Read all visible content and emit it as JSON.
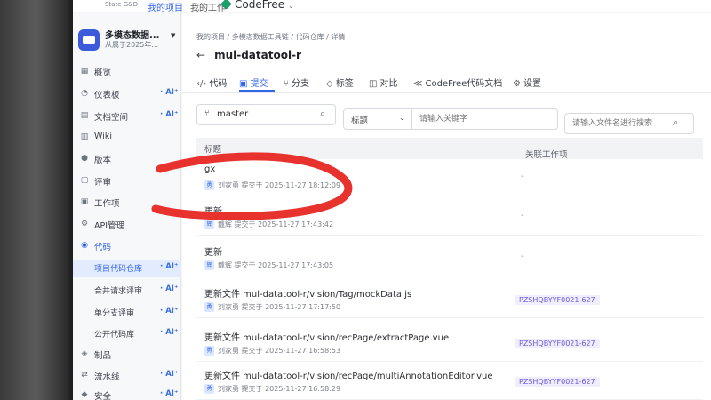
{
  "topbar": {
    "logo_sub": "State G&D",
    "my_projects": "我的项目",
    "my_work": "我的工作",
    "codefree": "CodeFree"
  },
  "project": {
    "name": "多模态数据...",
    "owner": "从属于2025年..."
  },
  "sidebar": {
    "ai_label": "AI",
    "items": [
      {
        "label": "概览",
        "icon": "grid-icon",
        "ai": false
      },
      {
        "label": "仪表板",
        "icon": "dashboard-icon",
        "ai": true
      },
      {
        "label": "文档空间",
        "icon": "document-icon",
        "ai": true
      },
      {
        "label": "Wiki",
        "icon": "wiki-icon",
        "ai": false
      },
      {
        "label": "版本",
        "icon": "version-icon",
        "ai": false
      },
      {
        "label": "评审",
        "icon": "review-icon",
        "ai": false
      },
      {
        "label": "工作项",
        "icon": "workitem-icon",
        "ai": false
      },
      {
        "label": "API管理",
        "icon": "api-icon",
        "ai": false
      },
      {
        "label": "代码",
        "icon": "code-icon",
        "ai": false
      },
      {
        "label": "项目代码仓库",
        "icon": "",
        "ai": true
      },
      {
        "label": "合并请求评审",
        "icon": "",
        "ai": true
      },
      {
        "label": "单分支评审",
        "icon": "",
        "ai": true
      },
      {
        "label": "公开代码库",
        "icon": "",
        "ai": true
      },
      {
        "label": "制品",
        "icon": "artifact-icon",
        "ai": false
      },
      {
        "label": "流水线",
        "icon": "pipeline-icon",
        "ai": true
      },
      {
        "label": "安全",
        "icon": "shield-icon",
        "ai": true
      }
    ]
  },
  "breadcrumb": "我的项目 / 多模态数据工具链 / 代码仓库 / 详情",
  "repo": {
    "back": "←",
    "title": "mul-datatool-r"
  },
  "tabs": [
    {
      "icon": "‹/›",
      "label": "代码"
    },
    {
      "icon": "▣",
      "label": "提交"
    },
    {
      "icon": "⑂",
      "label": "分支"
    },
    {
      "icon": "◇",
      "label": "标签"
    },
    {
      "icon": "◫",
      "label": "对比"
    },
    {
      "icon": "≪",
      "label": "CodeFree代码文档"
    },
    {
      "icon": "⚙",
      "label": "设置"
    }
  ],
  "filters": {
    "branch": "master",
    "field": "标题",
    "keyword_placeholder": "请输入关键字",
    "file_placeholder": "请输入文件名进行搜索"
  },
  "table": {
    "col_title": "标题",
    "col_workitem": "关联工作项",
    "rows": [
      {
        "title": "gx",
        "avatar": "勇",
        "meta": "刘家勇 提交于 2025-11-27 18:12:09",
        "workitem": "-"
      },
      {
        "title": "更新",
        "avatar": "辉",
        "meta": "戴辉 提交于 2025-11-27 17:43:42",
        "workitem": "-"
      },
      {
        "title": "更新",
        "avatar": "辉",
        "meta": "戴辉 提交于 2025-11-27 17:43:05",
        "workitem": "-"
      },
      {
        "title": "更新文件 mul-datatool-r/vision/Tag/mockData.js",
        "avatar": "勇",
        "meta": "刘家勇 提交于 2025-11-27 17:17:50",
        "workitem": "PZSHQBYYF0021-627"
      },
      {
        "title": "更新文件 mul-datatool-r/vision/recPage/extractPage.vue",
        "avatar": "勇",
        "meta": "刘家勇 提交于 2025-11-27 16:58:53",
        "workitem": "PZSHQBYYF0021-627"
      },
      {
        "title": "更新文件 mul-datatool-r/vision/recPage/multiAnnotationEditor.vue",
        "avatar": "勇",
        "meta": "刘家勇 提交于 2025-11-27 16:58:29",
        "workitem": "PZSHQBYYF0021-627"
      }
    ]
  },
  "colors": {
    "accent": "#3366e6",
    "annotation": "#e8322e"
  }
}
